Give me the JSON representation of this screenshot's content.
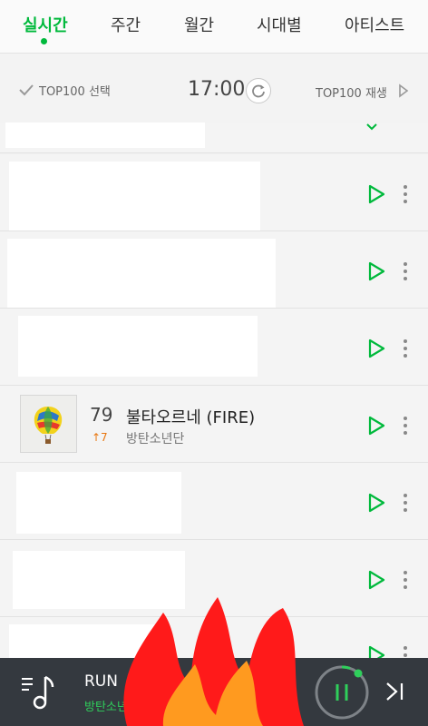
{
  "tabs": [
    {
      "label": "실시간",
      "active": true
    },
    {
      "label": "주간"
    },
    {
      "label": "월간"
    },
    {
      "label": "시대별"
    },
    {
      "label": "아티스트"
    }
  ],
  "controls": {
    "select_label": "TOP100 선택",
    "time": "17:00",
    "play_label": "TOP100 재생"
  },
  "featured_song": {
    "rank": "79",
    "change": "↑7",
    "title": "불타오르네 (FIRE)",
    "artist": "방탄소년단"
  },
  "player": {
    "title": "RUN",
    "artist": "방탄소년단",
    "progress": 0.05
  },
  "colors": {
    "accent": "#00b93c",
    "player_bg": "#34393f",
    "rank_up": "#e8760f"
  }
}
